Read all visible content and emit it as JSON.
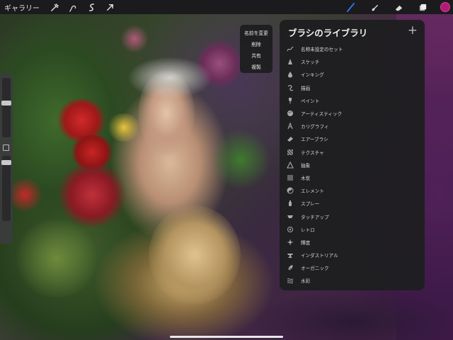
{
  "toolbar": {
    "gallery_label": "ギャラリー",
    "left_tools": [
      {
        "name": "adjustments-icon"
      },
      {
        "name": "selection-icon"
      },
      {
        "name": "transform-icon"
      },
      {
        "name": "arrow-icon"
      }
    ],
    "right_tools": [
      {
        "name": "brush-icon",
        "active_color": "#2f7dff"
      },
      {
        "name": "smudge-icon"
      },
      {
        "name": "eraser-icon"
      },
      {
        "name": "layers-icon"
      }
    ],
    "current_color": "#b01a7c"
  },
  "sidebar": {
    "brush_size_level": 0.2,
    "opacity_level": 0.2
  },
  "context_menu": {
    "items": [
      "名前を変更",
      "削除",
      "共有",
      "複製"
    ]
  },
  "brush_library": {
    "title": "ブラシのライブラリ",
    "add_label": "+",
    "sets": [
      {
        "label": "名称未設定のセット",
        "icon": "squiggle-icon"
      },
      {
        "label": "スケッチ",
        "icon": "pencil-tip-icon"
      },
      {
        "label": "インキング",
        "icon": "ink-drop-icon"
      },
      {
        "label": "描画",
        "icon": "swirl-icon"
      },
      {
        "label": "ペイント",
        "icon": "paint-brush-icon"
      },
      {
        "label": "アーティスティック",
        "icon": "palette-icon"
      },
      {
        "label": "カリグラフィ",
        "icon": "calligraphy-icon"
      },
      {
        "label": "エアーブラシ",
        "icon": "airbrush-icon"
      },
      {
        "label": "テクスチャ",
        "icon": "texture-icon"
      },
      {
        "label": "抽象",
        "icon": "triangle-icon"
      },
      {
        "label": "木炭",
        "icon": "charcoal-icon"
      },
      {
        "label": "エレメント",
        "icon": "yin-yang-icon"
      },
      {
        "label": "スプレー",
        "icon": "spray-icon"
      },
      {
        "label": "タッチアップ",
        "icon": "touchup-icon"
      },
      {
        "label": "レトロ",
        "icon": "retro-icon"
      },
      {
        "label": "輝度",
        "icon": "sparkle-icon"
      },
      {
        "label": "インダストリアル",
        "icon": "anvil-icon"
      },
      {
        "label": "オーガニック",
        "icon": "leaf-icon"
      },
      {
        "label": "水彩",
        "icon": "waves-icon"
      }
    ]
  }
}
